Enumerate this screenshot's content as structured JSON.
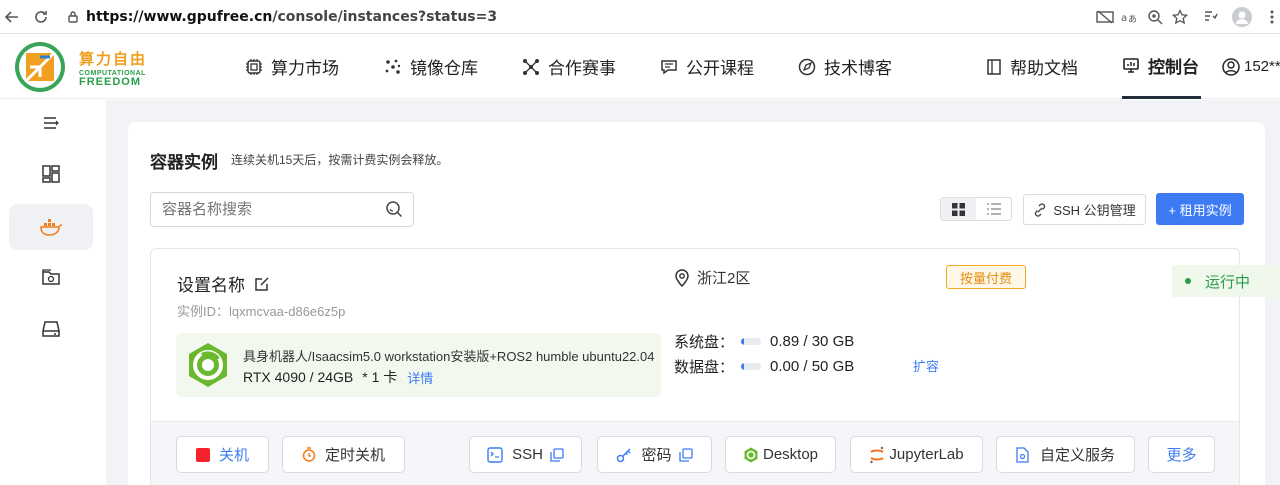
{
  "browser": {
    "url_host": "https://www.gpufree.cn",
    "url_path": "/console/instances?status=3"
  },
  "header": {
    "logo_cn": "算力自由",
    "logo_en1": "COMPUTATIONAL",
    "logo_en2": "FREEDOM",
    "nav": [
      {
        "label": "算力市场",
        "icon": "chip-icon"
      },
      {
        "label": "镜像仓库",
        "icon": "dots-icon"
      },
      {
        "label": "合作赛事",
        "icon": "network-icon"
      },
      {
        "label": "公开课程",
        "icon": "chat-icon"
      },
      {
        "label": "技术博客",
        "icon": "compass-icon"
      },
      {
        "label": "帮助文档",
        "icon": "book-icon"
      },
      {
        "label": "控制台",
        "icon": "monitor-icon",
        "active": true
      }
    ],
    "user": "152**"
  },
  "sidebar": {
    "items": [
      "menu-icon",
      "dashboard-icon",
      "container-icon",
      "image-icon",
      "storage-icon"
    ],
    "active_index": 2
  },
  "main": {
    "title": "容器实例",
    "subtitle": "连续关机15天后，按需计费实例会释放。",
    "search_placeholder": "容器名称搜索",
    "ssh_key_btn": "SSH 公钥管理",
    "rent_btn": "+ 租用实例"
  },
  "instance": {
    "name": "设置名称",
    "id_label": "实例ID：lqxmcvaa-d86e6z5p",
    "image_title": "具身机器人/Isaacsim5.0 workstation安装版+ROS2 humble ubuntu22.04",
    "gpu_spec": "RTX 4090 / 24GB",
    "gpu_count": "* 1 卡",
    "details_link": "详情",
    "region": "浙江2区",
    "billing": "按量付费",
    "status": "运行中",
    "system_disk_label": "系统盘：",
    "system_disk_value": "0.89 / 30 GB",
    "system_disk_fraction": 0.03,
    "data_disk_label": "数据盘：",
    "data_disk_value": "0.00 / 50 GB",
    "data_disk_fraction": 0.0,
    "expand_link": "扩容"
  },
  "actions": {
    "shutdown": "关机",
    "timer": "定时关机",
    "ssh": "SSH",
    "password": "密码",
    "desktop": "Desktop",
    "jupyter": "JupyterLab",
    "custom": "自定义服务",
    "more": "更多"
  },
  "colors": {
    "primary": "#3d7bf5",
    "success": "#2a9d4a",
    "warning": "#f5a623",
    "danger": "#f5222d"
  }
}
